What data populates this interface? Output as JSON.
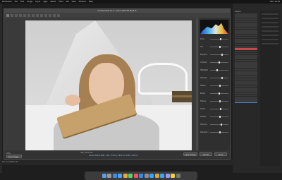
{
  "menubar": {
    "items": [
      "Photoshop",
      "File",
      "Edit",
      "Image",
      "Layer",
      "Type",
      "Select",
      "Filter",
      "3D",
      "View",
      "Window",
      "Help"
    ],
    "clock": "Mon 10:30"
  },
  "dialog": {
    "title": "Camera Raw 12.0 - Canon EOS 5D Mark III",
    "zoom": "25%",
    "file_info": "IMG_0423.CR2",
    "workflow_link": "Adobe RGB (1998); 8 bit; 5760 by 3840 (22.1MP); 300 ppi",
    "buttons": {
      "save": "Save Image...",
      "open": "Open Image",
      "cancel": "Cancel",
      "done": "Done"
    },
    "panel_sliders": [
      {
        "label": "Temp",
        "value": 0.55
      },
      {
        "label": "Tint",
        "value": 0.5
      },
      {
        "label": "Exposure",
        "value": 0.6
      },
      {
        "label": "Contrast",
        "value": 0.45
      },
      {
        "label": "Highlights",
        "value": 0.35
      },
      {
        "label": "Shadows",
        "value": 0.62
      },
      {
        "label": "Whites",
        "value": 0.5
      },
      {
        "label": "Blacks",
        "value": 0.48
      },
      {
        "label": "Texture",
        "value": 0.5
      },
      {
        "label": "Clarity",
        "value": 0.55
      },
      {
        "label": "Dehaze",
        "value": 0.5
      },
      {
        "label": "Vibrance",
        "value": 0.58
      },
      {
        "label": "Saturation",
        "value": 0.5
      }
    ]
  },
  "ps_status": "Doc: 63.3M/63.3M",
  "right_panel": {
    "title": "Layers"
  },
  "dock_icons": [
    "finder",
    "launchpad",
    "safari",
    "mail",
    "photos",
    "messages",
    "music",
    "app-store",
    "settings",
    "photoshop",
    "bridge",
    "lightroom",
    "premiere",
    "notes",
    "trash"
  ],
  "colors": {
    "accent_red": "#c24a4a",
    "accent_blue": "#4a6fa5"
  }
}
